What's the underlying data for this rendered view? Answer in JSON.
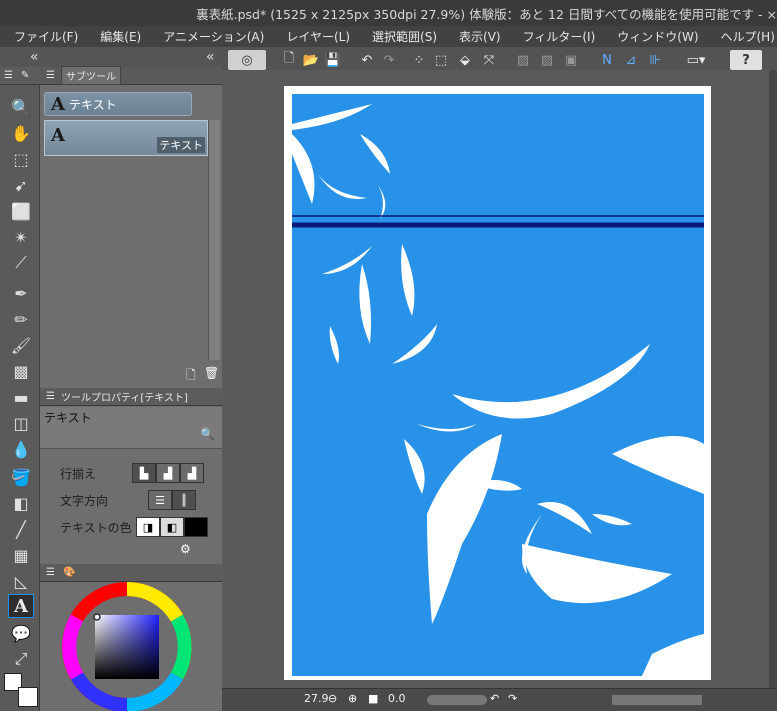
{
  "window": {
    "title": "裏表紙.psd* (1525 x 2125px 350dpi 27.9%)  体験版：あと 12 日間すべての機能を使用可能です - ×"
  },
  "menu": {
    "items": [
      "ファイル(F)",
      "編集(E)",
      "アニメーション(A)",
      "レイヤー(L)",
      "選択範囲(S)",
      "表示(V)",
      "フィルター(I)",
      "ウィンドウ(W)",
      "ヘルプ(H)"
    ]
  },
  "subtool_panel": {
    "tab_label": "サブツール",
    "group_label": "テキスト",
    "item_label": "テキスト"
  },
  "tool_property": {
    "header": "ツールプロパティ[テキスト]",
    "title": "テキスト",
    "rows": {
      "align_label": "行揃え",
      "direction_label": "文字方向",
      "color_label": "テキストの色"
    }
  },
  "status": {
    "zoom": "27.9",
    "rotation": "0.0"
  },
  "colors": {
    "accent": "#2792e8",
    "sky": "#2792e8",
    "dark_line": "#0b1a7a"
  }
}
